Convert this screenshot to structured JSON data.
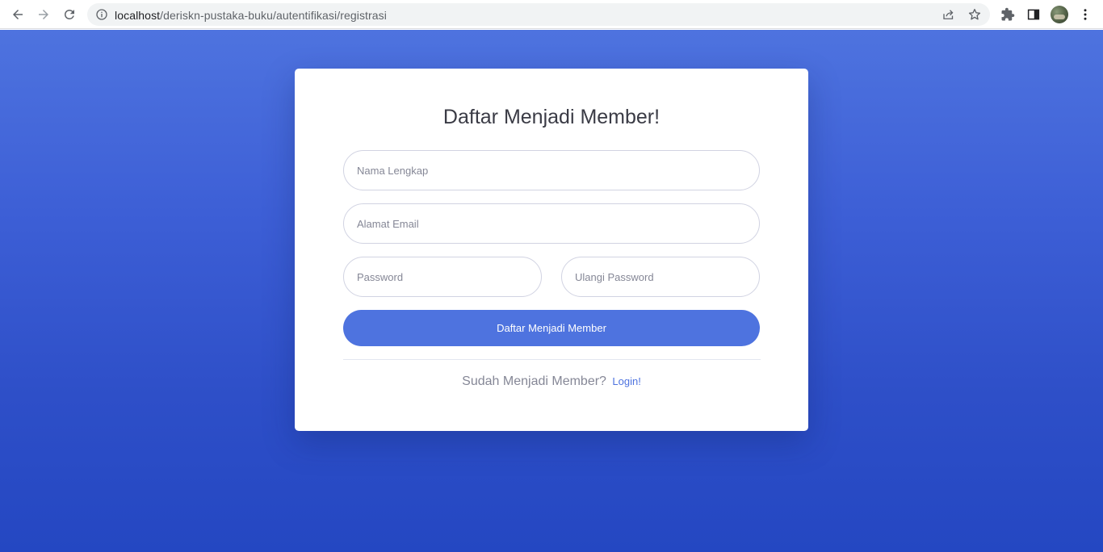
{
  "browser": {
    "url_host": "localhost",
    "url_path": "/deriskn-pustaka-buku/autentifikasi/registrasi",
    "icons": {
      "back": "arrow-left-icon",
      "forward": "arrow-right-icon",
      "reload": "reload-icon",
      "info": "info-icon",
      "share": "share-icon",
      "bookmark": "star-icon",
      "extensions": "puzzle-icon",
      "side_panel": "side-panel-icon",
      "profile": "avatar",
      "menu": "kebab-menu-icon"
    }
  },
  "theme": {
    "primary": "#4e73df",
    "background_gradient": [
      "#4e73df",
      "#2447c2"
    ],
    "text_dark": "#3a3b45",
    "text_muted": "#858796",
    "border": "#d1d3e2"
  },
  "form": {
    "title": "Daftar Menjadi Member!",
    "fields": {
      "full_name_placeholder": "Nama Lengkap",
      "email_placeholder": "Alamat Email",
      "password_placeholder": "Password",
      "repeat_password_placeholder": "Ulangi Password"
    },
    "submit_label": "Daftar Menjadi Member",
    "login_prompt": "Sudah Menjadi Member?",
    "login_link": "Login!"
  }
}
